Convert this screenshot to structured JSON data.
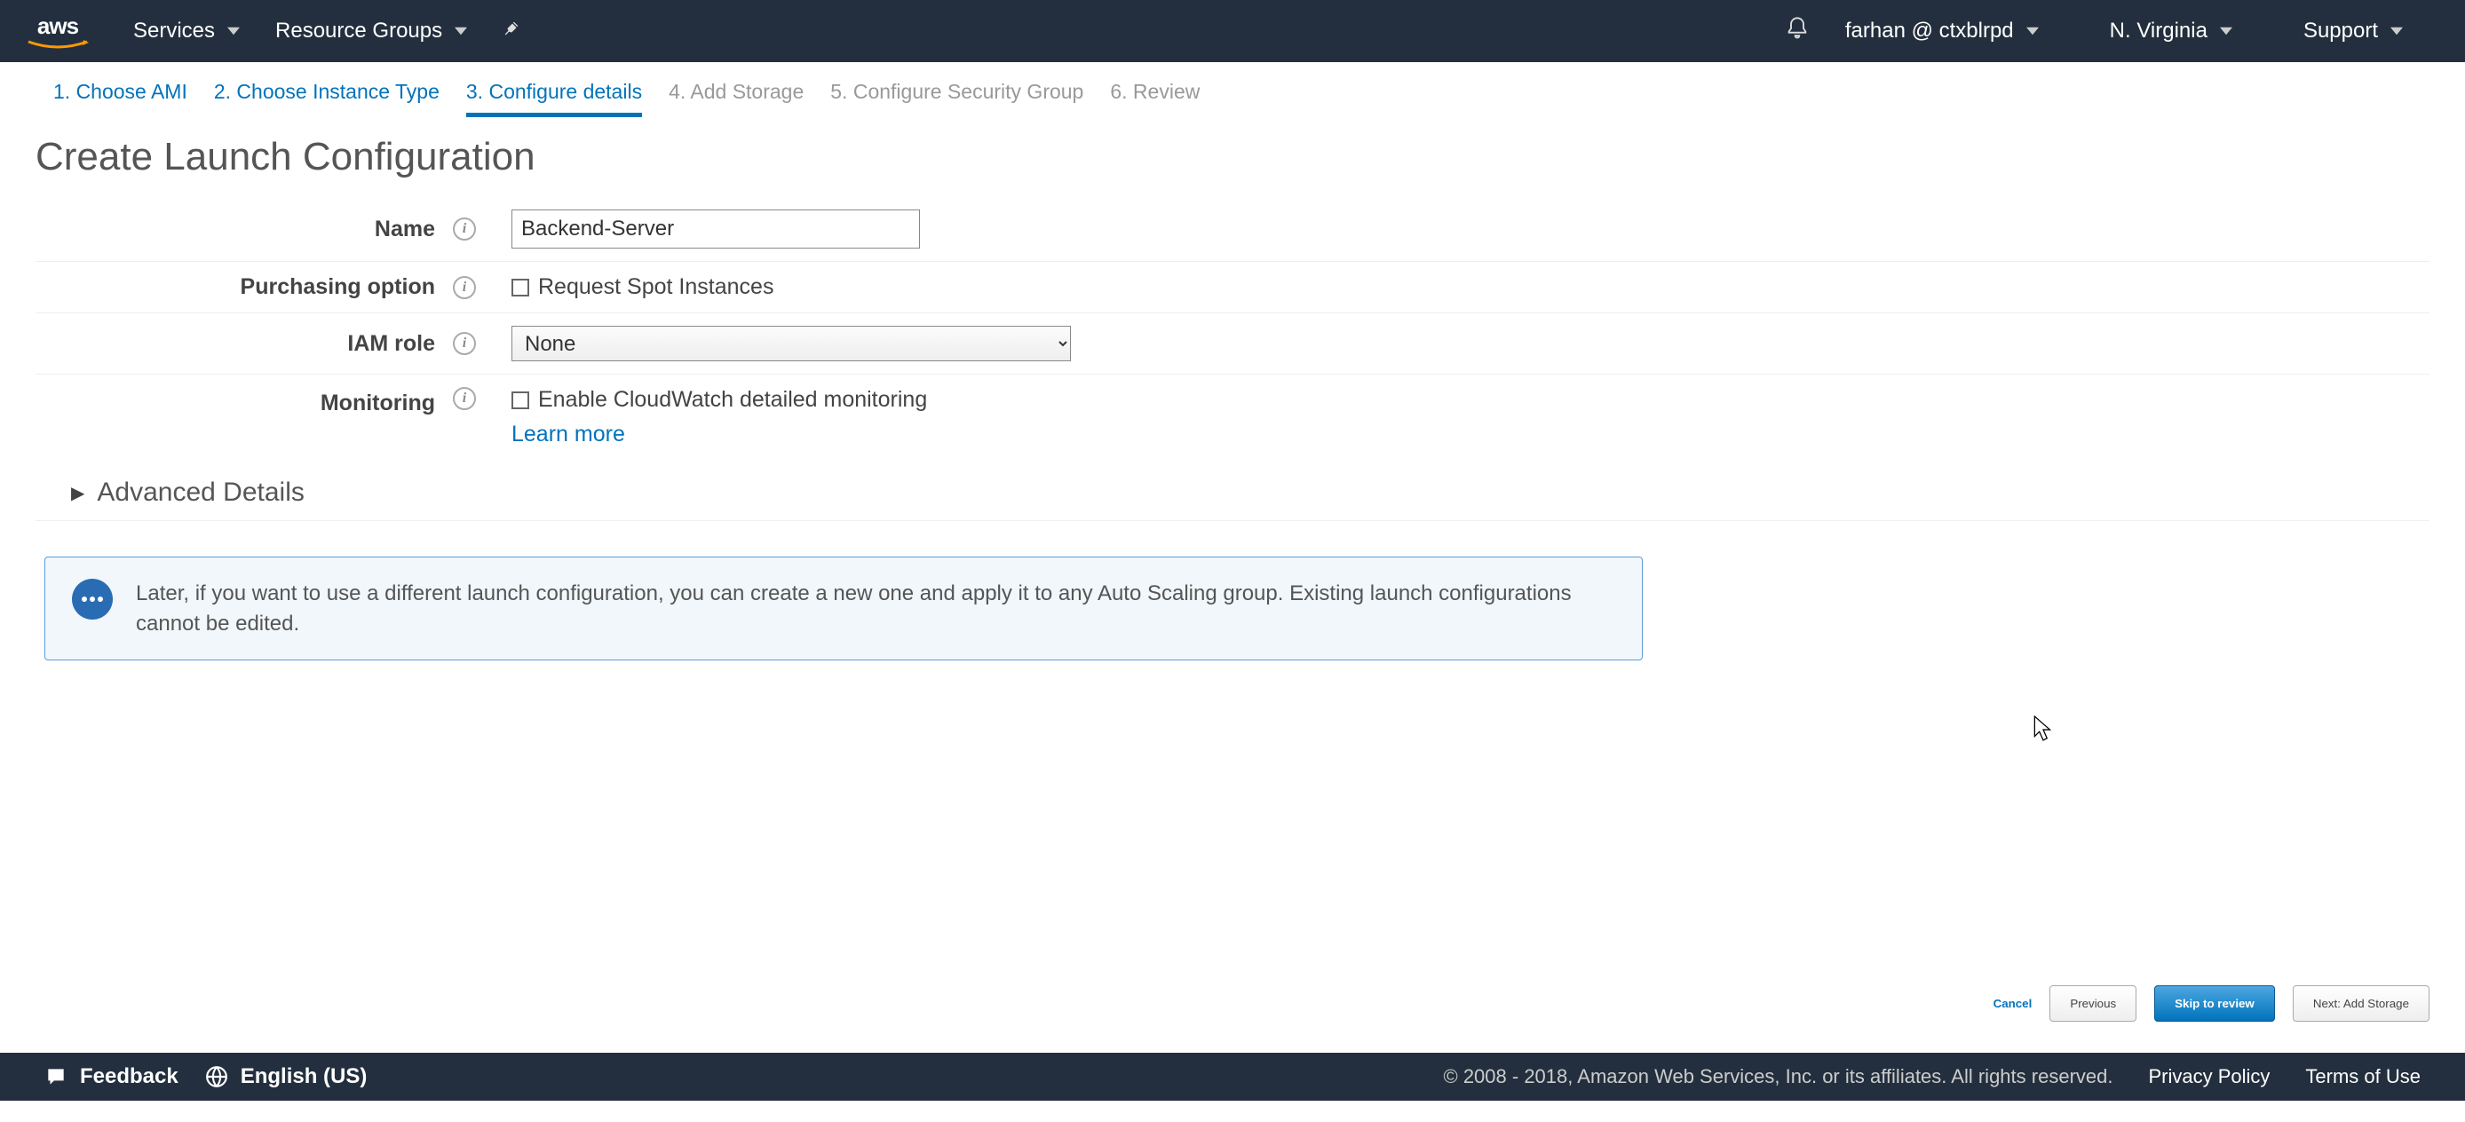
{
  "topnav": {
    "logo": "aws",
    "services": "Services",
    "resource_groups": "Resource Groups",
    "account": "farhan @ ctxblrpd",
    "region": "N. Virginia",
    "support": "Support"
  },
  "wizard": {
    "step1": "1. Choose AMI",
    "step2": "2. Choose Instance Type",
    "step3": "3. Configure details",
    "step4": "4. Add Storage",
    "step5": "5. Configure Security Group",
    "step6": "6. Review"
  },
  "page": {
    "title": "Create Launch Configuration"
  },
  "form": {
    "name_label": "Name",
    "name_value": "Backend-Server",
    "purchasing_label": "Purchasing option",
    "purchasing_checkbox": "Request Spot Instances",
    "iam_label": "IAM role",
    "iam_selected": "None",
    "monitoring_label": "Monitoring",
    "monitoring_checkbox": "Enable CloudWatch detailed monitoring",
    "learn_more": "Learn more",
    "advanced": "Advanced Details"
  },
  "infobox": {
    "text": "Later, if you want to use a different launch configuration, you can create a new one and apply it to any Auto Scaling group. Existing launch configurations cannot be edited."
  },
  "buttons": {
    "cancel": "Cancel",
    "previous": "Previous",
    "skip": "Skip to review",
    "next": "Next: Add Storage"
  },
  "footer": {
    "feedback": "Feedback",
    "language": "English (US)",
    "copyright": "© 2008 - 2018, Amazon Web Services, Inc. or its affiliates. All rights reserved.",
    "privacy": "Privacy Policy",
    "terms": "Terms of Use"
  }
}
